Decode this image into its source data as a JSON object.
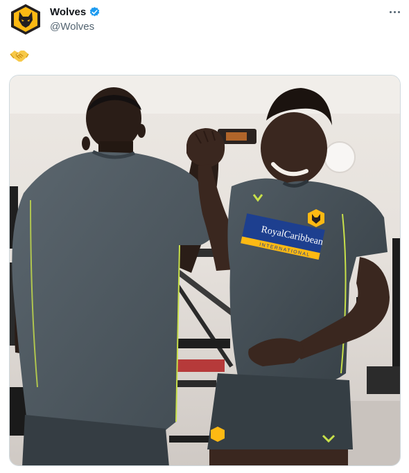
{
  "account": {
    "name": "Wolves",
    "handle": "@Wolves",
    "verified": true,
    "avatar_icon": "wolves-crest-icon",
    "brand_color": "#fdb913"
  },
  "menu": {
    "icon": "more-options-icon"
  },
  "tweet": {
    "emoji": "handshake-emoji",
    "emoji_color": "#f7c948"
  },
  "media": {
    "jersey_sponsor": {
      "line1": "RoyalCaribbean",
      "line2": "INTERNATIONAL"
    },
    "kit_color": "#3f4a52",
    "accent_color": "#c8e04a"
  }
}
